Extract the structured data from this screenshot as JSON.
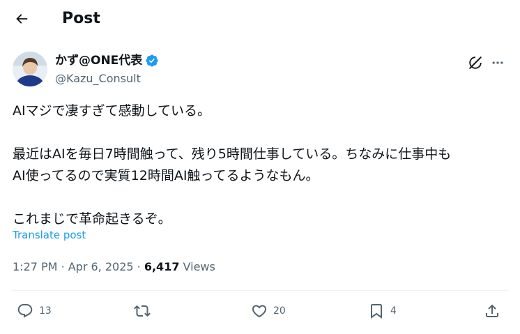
{
  "header": {
    "back_icon": "arrow-left-icon",
    "title": "Post"
  },
  "author": {
    "name": "かず@ONE代表",
    "handle": "@Kazu_Consult",
    "verified_color": "#1d9bf0"
  },
  "tweet": {
    "text": "AIマジで凄すぎて感動している。\n\n最近はAIを毎日7時間触って、残り5時間仕事している。ちなみに仕事中も\nAI使ってるので実質12時間AI触ってるようなもん。\n\nこれまじで革命起きるぞ。",
    "translate_label": "Translate post",
    "time": "1:27 PM",
    "date": "Apr 6, 2025",
    "views_count": "6,417",
    "views_label": "Views"
  },
  "actions": {
    "reply_count": "13",
    "repost_count": "",
    "like_count": "20",
    "bookmark_count": "4"
  },
  "colors": {
    "accent": "#1d9bf0",
    "secondary_text": "#536471",
    "primary_text": "#0f1419"
  }
}
